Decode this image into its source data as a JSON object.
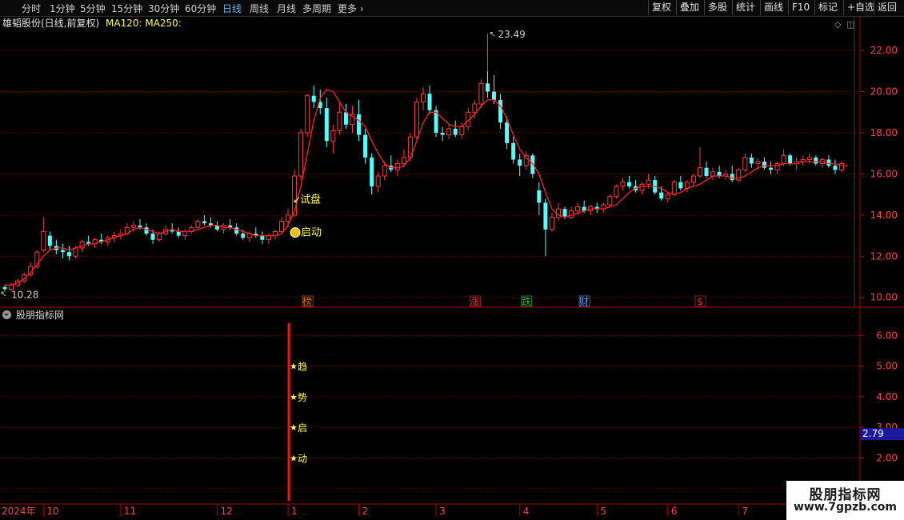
{
  "toolbar": {
    "periods": [
      "分时",
      "1分钟",
      "5分钟",
      "15分钟",
      "30分钟",
      "60分钟",
      "日线",
      "周线",
      "月线",
      "多周期",
      "更多"
    ],
    "active_period": "日线",
    "right_buttons": [
      "复权",
      "叠加",
      "多股",
      "统计",
      "画线",
      "F10",
      "标记",
      "+自选",
      "返回"
    ]
  },
  "main_chart": {
    "title": "雄韬股份(日线,前复权)",
    "ma_legend": "MA120: MA250:",
    "y_ticks": [
      "22.00",
      "20.00",
      "18.00",
      "16.00",
      "14.00",
      "12.00",
      "10.00"
    ],
    "high_label": "23.49",
    "low_label": "10.28",
    "annotations": [
      "试盘",
      "启动"
    ],
    "event_markers": [
      {
        "text": "榜",
        "color": "#e07020"
      },
      {
        "text": "涨",
        "color": "#e03030"
      },
      {
        "text": "跌",
        "color": "#30c030"
      },
      {
        "text": "财",
        "color": "#6aa0ff"
      },
      {
        "text": "$",
        "color": "#e03030"
      }
    ]
  },
  "sub_chart": {
    "title": "股朋指标网",
    "y_ticks": [
      "6.00",
      "5.00",
      "4.00",
      "3.00",
      "2.00",
      "1.00"
    ],
    "current_value": "2.79",
    "star_labels": [
      "趋",
      "势",
      "启",
      "动"
    ]
  },
  "x_axis": {
    "labels": [
      "2024年",
      "10",
      "11",
      "12",
      "1",
      "2",
      "3",
      "4",
      "5",
      "6",
      "7"
    ]
  },
  "watermark": {
    "title": "股朋指标网",
    "url": "www.7gpzb.com"
  },
  "colors": {
    "up": "#ff3a3a",
    "down": "#54fcfc",
    "ma_line": "#ff2020",
    "axis": "#b00000",
    "active_tab": "#5fb7ff",
    "annotation": "#ffff40"
  },
  "chart_data": {
    "type": "candlestick",
    "ylabel": "",
    "ylim": [
      9.6,
      23.6
    ],
    "series": [
      {
        "values": [
          [
            10.5,
            10.6,
            10.28,
            10.4
          ],
          [
            10.4,
            10.7,
            10.3,
            10.6
          ],
          [
            10.6,
            10.9,
            10.5,
            10.8
          ],
          [
            10.8,
            11.2,
            10.7,
            11.1
          ],
          [
            11.1,
            11.7,
            11.0,
            11.5
          ],
          [
            11.5,
            12.3,
            11.4,
            12.2
          ],
          [
            12.3,
            13.9,
            12.2,
            13.2
          ],
          [
            13.0,
            13.2,
            12.3,
            12.5
          ],
          [
            12.5,
            12.8,
            12.1,
            12.3
          ],
          [
            12.3,
            12.6,
            11.9,
            12.2
          ],
          [
            12.2,
            12.5,
            11.8,
            12.0
          ],
          [
            12.0,
            12.5,
            11.9,
            12.4
          ],
          [
            12.4,
            12.8,
            12.2,
            12.7
          ],
          [
            12.7,
            13.0,
            12.5,
            12.6
          ],
          [
            12.6,
            12.9,
            12.4,
            12.8
          ],
          [
            12.8,
            13.1,
            12.6,
            12.7
          ],
          [
            12.7,
            13.0,
            12.5,
            12.9
          ],
          [
            12.9,
            13.2,
            12.7,
            13.0
          ],
          [
            13.0,
            13.3,
            12.8,
            13.1
          ],
          [
            13.1,
            13.6,
            13.0,
            13.4
          ],
          [
            13.4,
            13.7,
            13.2,
            13.5
          ],
          [
            13.5,
            13.8,
            13.3,
            13.4
          ],
          [
            13.4,
            13.6,
            13.0,
            13.1
          ],
          [
            13.1,
            13.3,
            12.6,
            12.8
          ],
          [
            12.8,
            13.2,
            12.7,
            13.1
          ],
          [
            13.1,
            13.5,
            13.0,
            13.3
          ],
          [
            13.3,
            13.6,
            13.1,
            13.2
          ],
          [
            13.2,
            13.4,
            12.9,
            13.0
          ],
          [
            13.0,
            13.3,
            12.8,
            13.2
          ],
          [
            13.2,
            13.5,
            13.1,
            13.4
          ],
          [
            13.4,
            13.8,
            13.3,
            13.7
          ],
          [
            13.7,
            14.0,
            13.5,
            13.6
          ],
          [
            13.6,
            13.9,
            13.4,
            13.5
          ],
          [
            13.5,
            13.7,
            13.2,
            13.3
          ],
          [
            13.3,
            13.6,
            13.1,
            13.5
          ],
          [
            13.5,
            13.8,
            13.3,
            13.4
          ],
          [
            13.4,
            13.6,
            13.0,
            13.1
          ],
          [
            13.1,
            13.3,
            12.8,
            12.9
          ],
          [
            12.9,
            13.2,
            12.7,
            13.1
          ],
          [
            13.1,
            13.4,
            12.9,
            13.0
          ],
          [
            13.0,
            13.2,
            12.6,
            12.8
          ],
          [
            12.8,
            13.1,
            12.6,
            13.0
          ],
          [
            13.0,
            13.3,
            12.8,
            13.2
          ],
          [
            13.2,
            13.9,
            13.1,
            13.7
          ],
          [
            13.7,
            14.3,
            13.4,
            14.0
          ],
          [
            14.0,
            16.2,
            13.9,
            15.9
          ],
          [
            15.9,
            18.2,
            15.7,
            18.0
          ],
          [
            18.0,
            19.9,
            17.8,
            19.8
          ],
          [
            19.8,
            20.3,
            19.2,
            19.5
          ],
          [
            19.5,
            20.1,
            18.9,
            19.2
          ],
          [
            19.2,
            19.7,
            17.3,
            17.6
          ],
          [
            17.6,
            18.4,
            17.0,
            18.1
          ],
          [
            18.1,
            19.5,
            17.9,
            19.0
          ],
          [
            19.0,
            19.4,
            18.2,
            18.4
          ],
          [
            18.4,
            19.3,
            18.0,
            18.9
          ],
          [
            18.9,
            19.6,
            17.6,
            17.9
          ],
          [
            17.9,
            18.2,
            16.5,
            16.8
          ],
          [
            16.8,
            17.0,
            15.0,
            15.4
          ],
          [
            15.4,
            16.1,
            15.1,
            15.9
          ],
          [
            15.9,
            16.6,
            15.7,
            16.4
          ],
          [
            16.4,
            16.9,
            16.1,
            16.2
          ],
          [
            16.2,
            16.7,
            15.9,
            16.5
          ],
          [
            16.5,
            17.2,
            16.3,
            16.8
          ],
          [
            16.8,
            18.0,
            16.6,
            17.8
          ],
          [
            17.8,
            19.7,
            17.6,
            19.5
          ],
          [
            19.5,
            20.2,
            19.1,
            19.9
          ],
          [
            19.9,
            20.3,
            18.9,
            19.1
          ],
          [
            19.1,
            19.3,
            17.8,
            18.0
          ],
          [
            18.0,
            18.3,
            17.6,
            17.9
          ],
          [
            17.9,
            18.4,
            17.7,
            18.2
          ],
          [
            18.2,
            18.6,
            17.8,
            17.9
          ],
          [
            17.9,
            18.5,
            17.7,
            18.3
          ],
          [
            18.3,
            19.2,
            18.1,
            19.0
          ],
          [
            19.0,
            19.6,
            18.7,
            19.4
          ],
          [
            19.4,
            20.6,
            19.2,
            20.4
          ],
          [
            20.4,
            21.0,
            19.7,
            20.0
          ],
          [
            20.0,
            20.8,
            19.4,
            19.6
          ],
          [
            19.6,
            19.9,
            18.2,
            18.5
          ],
          [
            18.5,
            18.8,
            17.2,
            17.5
          ],
          [
            17.5,
            17.8,
            16.5,
            16.7
          ],
          [
            16.7,
            17.0,
            15.9,
            16.4
          ],
          [
            16.4,
            17.1,
            16.2,
            16.9
          ],
          [
            16.9,
            17.0,
            15.8,
            16.0
          ],
          [
            15.2,
            15.6,
            14.0,
            14.6
          ],
          [
            14.6,
            14.8,
            12.0,
            13.3
          ],
          [
            13.3,
            14.1,
            13.2,
            13.9
          ],
          [
            13.9,
            14.6,
            13.7,
            14.3
          ],
          [
            14.3,
            14.4,
            13.8,
            13.9
          ],
          [
            13.9,
            14.4,
            13.8,
            14.2
          ],
          [
            14.2,
            14.6,
            14.0,
            14.4
          ],
          [
            14.4,
            14.7,
            14.1,
            14.2
          ],
          [
            14.2,
            14.5,
            14.0,
            14.4
          ],
          [
            14.4,
            14.6,
            14.1,
            14.3
          ],
          [
            14.3,
            14.6,
            14.1,
            14.5
          ],
          [
            14.5,
            15.0,
            14.4,
            14.9
          ],
          [
            14.9,
            15.5,
            14.8,
            15.4
          ],
          [
            15.4,
            15.8,
            15.2,
            15.6
          ],
          [
            15.6,
            15.9,
            15.3,
            15.4
          ],
          [
            15.4,
            15.7,
            15.1,
            15.2
          ],
          [
            15.2,
            15.6,
            15.0,
            15.5
          ],
          [
            15.5,
            16.0,
            15.3,
            15.7
          ],
          [
            15.7,
            15.9,
            15.0,
            15.1
          ],
          [
            15.1,
            15.4,
            14.7,
            14.8
          ],
          [
            14.8,
            15.1,
            14.6,
            15.0
          ],
          [
            15.0,
            15.7,
            14.9,
            15.6
          ],
          [
            15.6,
            15.9,
            15.2,
            15.3
          ],
          [
            15.3,
            15.7,
            15.1,
            15.6
          ],
          [
            15.6,
            16.0,
            15.4,
            15.9
          ],
          [
            15.9,
            17.3,
            15.8,
            16.3
          ],
          [
            16.3,
            16.6,
            15.8,
            15.9
          ],
          [
            15.9,
            16.3,
            15.7,
            16.1
          ],
          [
            16.1,
            16.4,
            15.8,
            15.9
          ],
          [
            15.9,
            16.2,
            15.7,
            16.0
          ],
          [
            16.0,
            16.4,
            15.6,
            15.7
          ],
          [
            15.7,
            16.3,
            15.6,
            16.2
          ],
          [
            16.2,
            17.0,
            16.1,
            16.8
          ],
          [
            16.8,
            17.0,
            16.3,
            16.5
          ],
          [
            16.5,
            16.8,
            16.2,
            16.6
          ],
          [
            16.6,
            16.8,
            16.2,
            16.3
          ],
          [
            16.3,
            16.6,
            16.0,
            16.2
          ],
          [
            16.2,
            16.6,
            16.0,
            16.5
          ],
          [
            16.5,
            17.2,
            16.4,
            16.9
          ],
          [
            16.9,
            17.0,
            16.4,
            16.5
          ],
          [
            16.5,
            16.8,
            16.2,
            16.6
          ],
          [
            16.6,
            16.9,
            16.4,
            16.7
          ],
          [
            16.7,
            17.0,
            16.5,
            16.8
          ],
          [
            16.8,
            16.9,
            16.4,
            16.5
          ],
          [
            16.5,
            16.8,
            16.3,
            16.7
          ],
          [
            16.7,
            16.9,
            16.3,
            16.4
          ],
          [
            16.4,
            16.7,
            16.0,
            16.2
          ],
          [
            16.2,
            16.6,
            16.1,
            16.5
          ]
        ]
      }
    ],
    "ma_line": [
      10.6,
      10.6,
      10.7,
      10.9,
      11.2,
      11.6,
      12.0,
      12.3,
      12.4,
      12.4,
      12.3,
      12.4,
      12.5,
      12.6,
      12.6,
      12.7,
      12.8,
      12.9,
      13.0,
      13.1,
      13.3,
      13.4,
      13.3,
      13.2,
      13.1,
      13.2,
      13.3,
      13.2,
      13.2,
      13.2,
      13.3,
      13.4,
      13.5,
      13.5,
      13.4,
      13.4,
      13.3,
      13.2,
      13.1,
      13.0,
      13.0,
      13.0,
      13.0,
      13.1,
      13.5,
      14.2,
      15.4,
      17.0,
      18.6,
      19.7,
      20.1,
      20.0,
      19.5,
      19.0,
      18.8,
      18.6,
      18.3,
      17.6,
      17.0,
      16.5,
      16.3,
      16.3,
      16.4,
      16.8,
      17.6,
      18.5,
      19.0,
      19.0,
      18.7,
      18.4,
      18.3,
      18.3,
      18.6,
      18.9,
      19.3,
      19.6,
      19.6,
      19.3,
      18.7,
      17.9,
      17.2,
      16.8,
      16.5,
      16.0,
      15.1,
      14.3,
      14.0,
      13.9,
      14.0,
      14.1,
      14.2,
      14.3,
      14.3,
      14.3,
      14.4,
      14.5,
      14.8,
      15.1,
      15.3,
      15.4,
      15.4,
      15.4,
      15.3,
      15.1,
      15.0,
      15.1,
      15.3,
      15.4,
      15.5,
      15.7,
      15.9,
      15.9,
      15.9,
      15.8,
      15.8,
      15.9,
      16.1,
      16.3,
      16.4,
      16.4,
      16.4,
      16.5,
      16.5,
      16.5,
      16.6,
      16.6,
      16.6,
      16.6,
      16.5,
      16.5,
      16.4,
      16.4
    ],
    "indicator": {
      "signal_at": "1月",
      "stars": [
        5,
        4,
        3,
        2
      ],
      "current": 2.79,
      "ylim": [
        0.6,
        6.4
      ]
    }
  }
}
